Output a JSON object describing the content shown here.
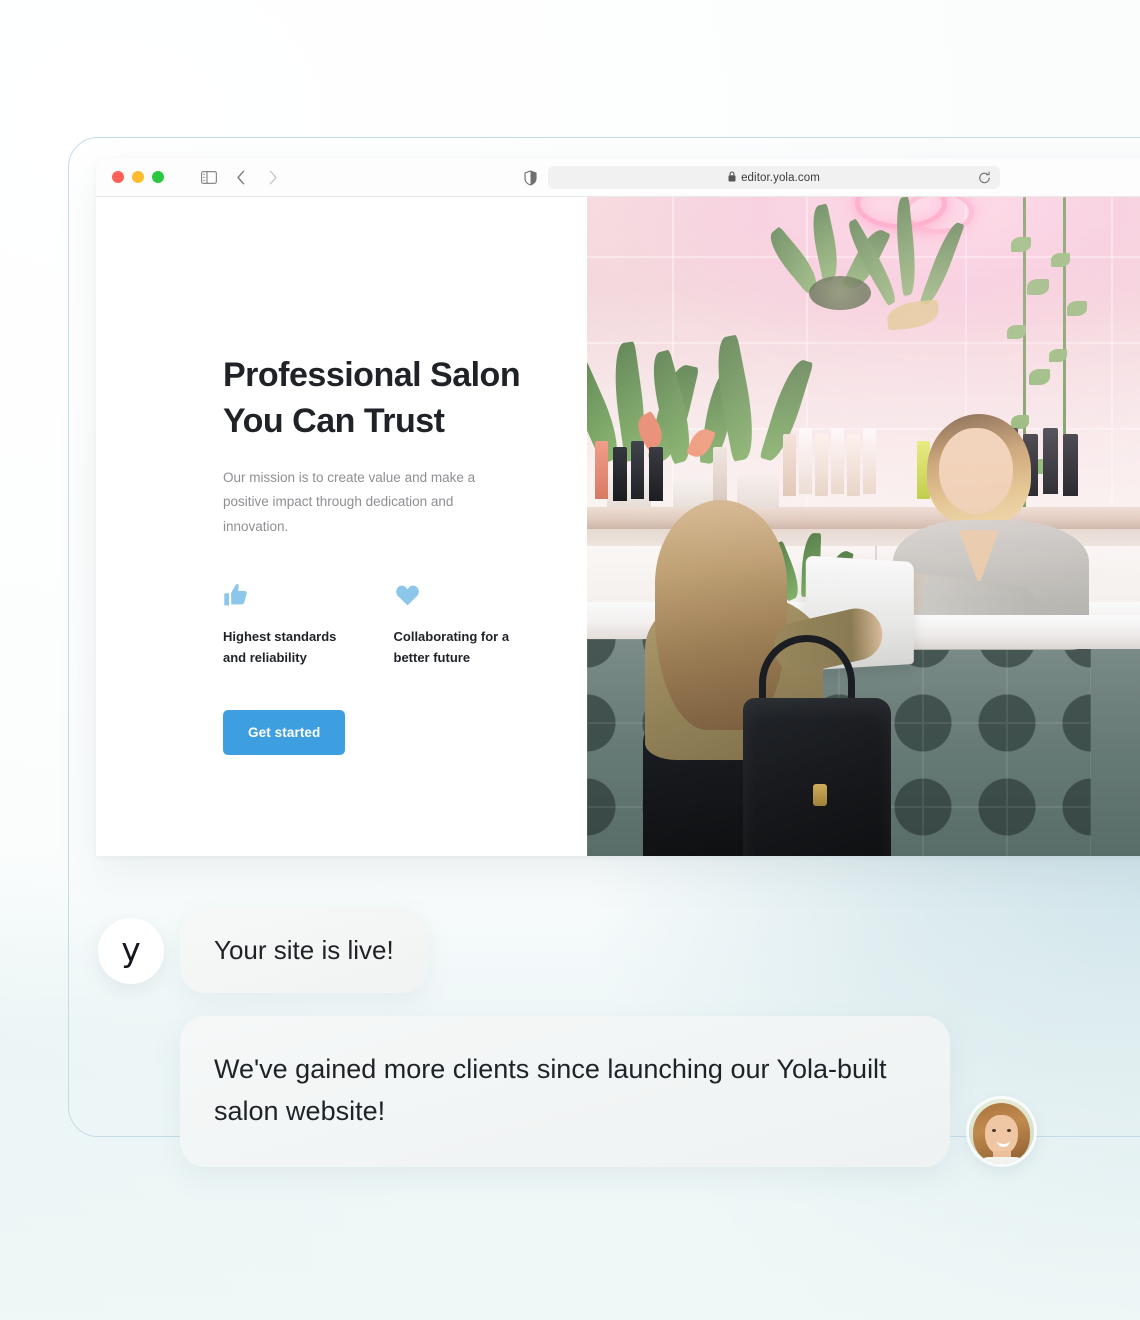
{
  "browser": {
    "traffic_lights": [
      "close",
      "minimize",
      "maximize"
    ],
    "sidebar_icon": "sidebar-toggle-icon",
    "back_icon": "chevron-left-icon",
    "forward_icon": "chevron-right-icon",
    "shield_icon": "privacy-shield-icon",
    "lock_icon": "lock-icon",
    "url": "editor.yola.com",
    "reload_icon": "reload-icon"
  },
  "site": {
    "title": "Professional Salon You Can Trust",
    "subtitle": "Our mission is to create value and make a positive impact through dedication and innovation.",
    "features": [
      {
        "icon": "thumbs-up-icon",
        "label": "Highest standards and reliability"
      },
      {
        "icon": "heart-icon",
        "label": "Collaborating for a better future"
      }
    ],
    "cta_label": "Get started",
    "photo_alt": "salon-reception-photo"
  },
  "chat": {
    "messages": [
      {
        "avatar": "yola-logo-avatar",
        "avatar_mark": "y",
        "text": "Your site is live!"
      },
      {
        "avatar": "client-photo-avatar",
        "text": "We've gained more clients since launching our Yola-built salon website!"
      }
    ]
  },
  "colors": {
    "accent_blue": "#3d9fe0",
    "feature_icon_blue": "#8cc6ea",
    "frame_border": "#c3dcea",
    "text_dark": "#1f2328",
    "text_muted": "#8d8f93",
    "bubble_bg": "#f2f5f5",
    "page_bg_end": "#e7f2f3"
  }
}
